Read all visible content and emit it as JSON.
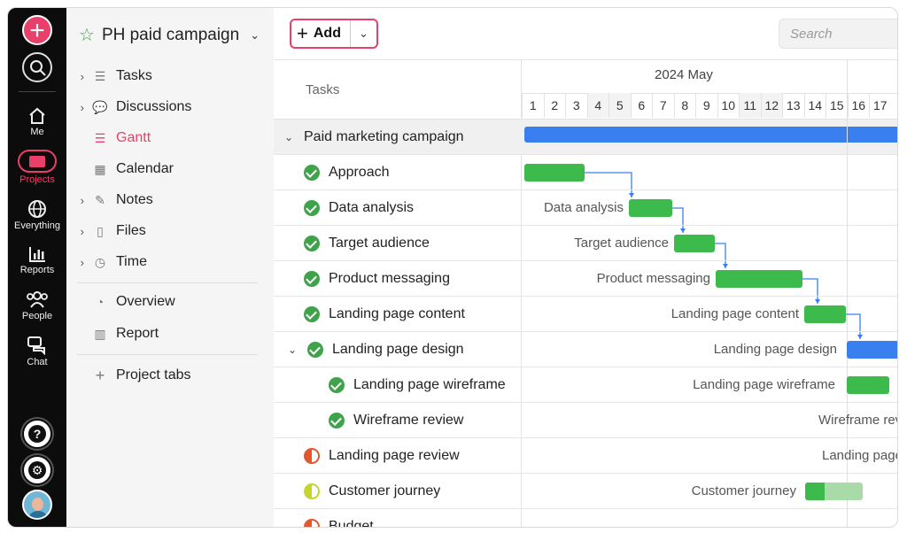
{
  "rail": {
    "items": [
      {
        "label": "Me"
      },
      {
        "label": "Projects"
      },
      {
        "label": "Everything"
      },
      {
        "label": "Reports"
      },
      {
        "label": "People"
      },
      {
        "label": "Chat"
      }
    ],
    "accent": "#e8406b"
  },
  "sidebar": {
    "project_title": "PH paid campaign",
    "nav": [
      {
        "label": "Tasks",
        "icon": "checklist-icon",
        "expandable": true
      },
      {
        "label": "Discussions",
        "icon": "speech-bubble-icon",
        "expandable": true
      },
      {
        "label": "Gantt",
        "icon": "gantt-icon",
        "active": true
      },
      {
        "label": "Calendar",
        "icon": "calendar-icon"
      },
      {
        "label": "Notes",
        "icon": "notes-icon",
        "expandable": true
      },
      {
        "label": "Files",
        "icon": "file-icon",
        "expandable": true
      },
      {
        "label": "Time",
        "icon": "clock-icon",
        "expandable": true
      },
      {
        "label": "Overview",
        "icon": "gauge-icon"
      },
      {
        "label": "Report",
        "icon": "bar-chart-icon"
      }
    ],
    "project_tabs_label": "Project tabs"
  },
  "toolbar": {
    "add_label": "Add",
    "search_placeholder": "Search"
  },
  "gantt": {
    "tasks_header": "Tasks",
    "month_label": "2024 May",
    "days": [
      "1",
      "2",
      "3",
      "4",
      "5",
      "6",
      "7",
      "8",
      "9",
      "10",
      "11",
      "12",
      "13",
      "14",
      "15",
      "16",
      "17"
    ],
    "group_label": "Paid marketing campaign",
    "rows": [
      {
        "name": "Approach",
        "status": "done",
        "bar_label": ""
      },
      {
        "name": "Data analysis",
        "status": "done",
        "bar_label": "Data analysis"
      },
      {
        "name": "Target audience",
        "status": "done",
        "bar_label": "Target audience"
      },
      {
        "name": "Product messaging",
        "status": "done",
        "bar_label": "Product messaging"
      },
      {
        "name": "Landing page content",
        "status": "done",
        "bar_label": "Landing page content"
      },
      {
        "name": "Landing page design",
        "status": "done",
        "bar_label": "Landing page design"
      },
      {
        "name": "Landing page wireframe",
        "status": "done",
        "bar_label": "Landing page wireframe"
      },
      {
        "name": "Wireframe review",
        "status": "done",
        "bar_label": "Wireframe rev"
      },
      {
        "name": "Landing page review",
        "status": "in-progress",
        "bar_label": "Landing page"
      },
      {
        "name": "Customer journey",
        "status": "in-progress",
        "bar_label": "Customer journey"
      },
      {
        "name": "Budget",
        "status": "in-progress",
        "bar_label": ""
      }
    ]
  }
}
